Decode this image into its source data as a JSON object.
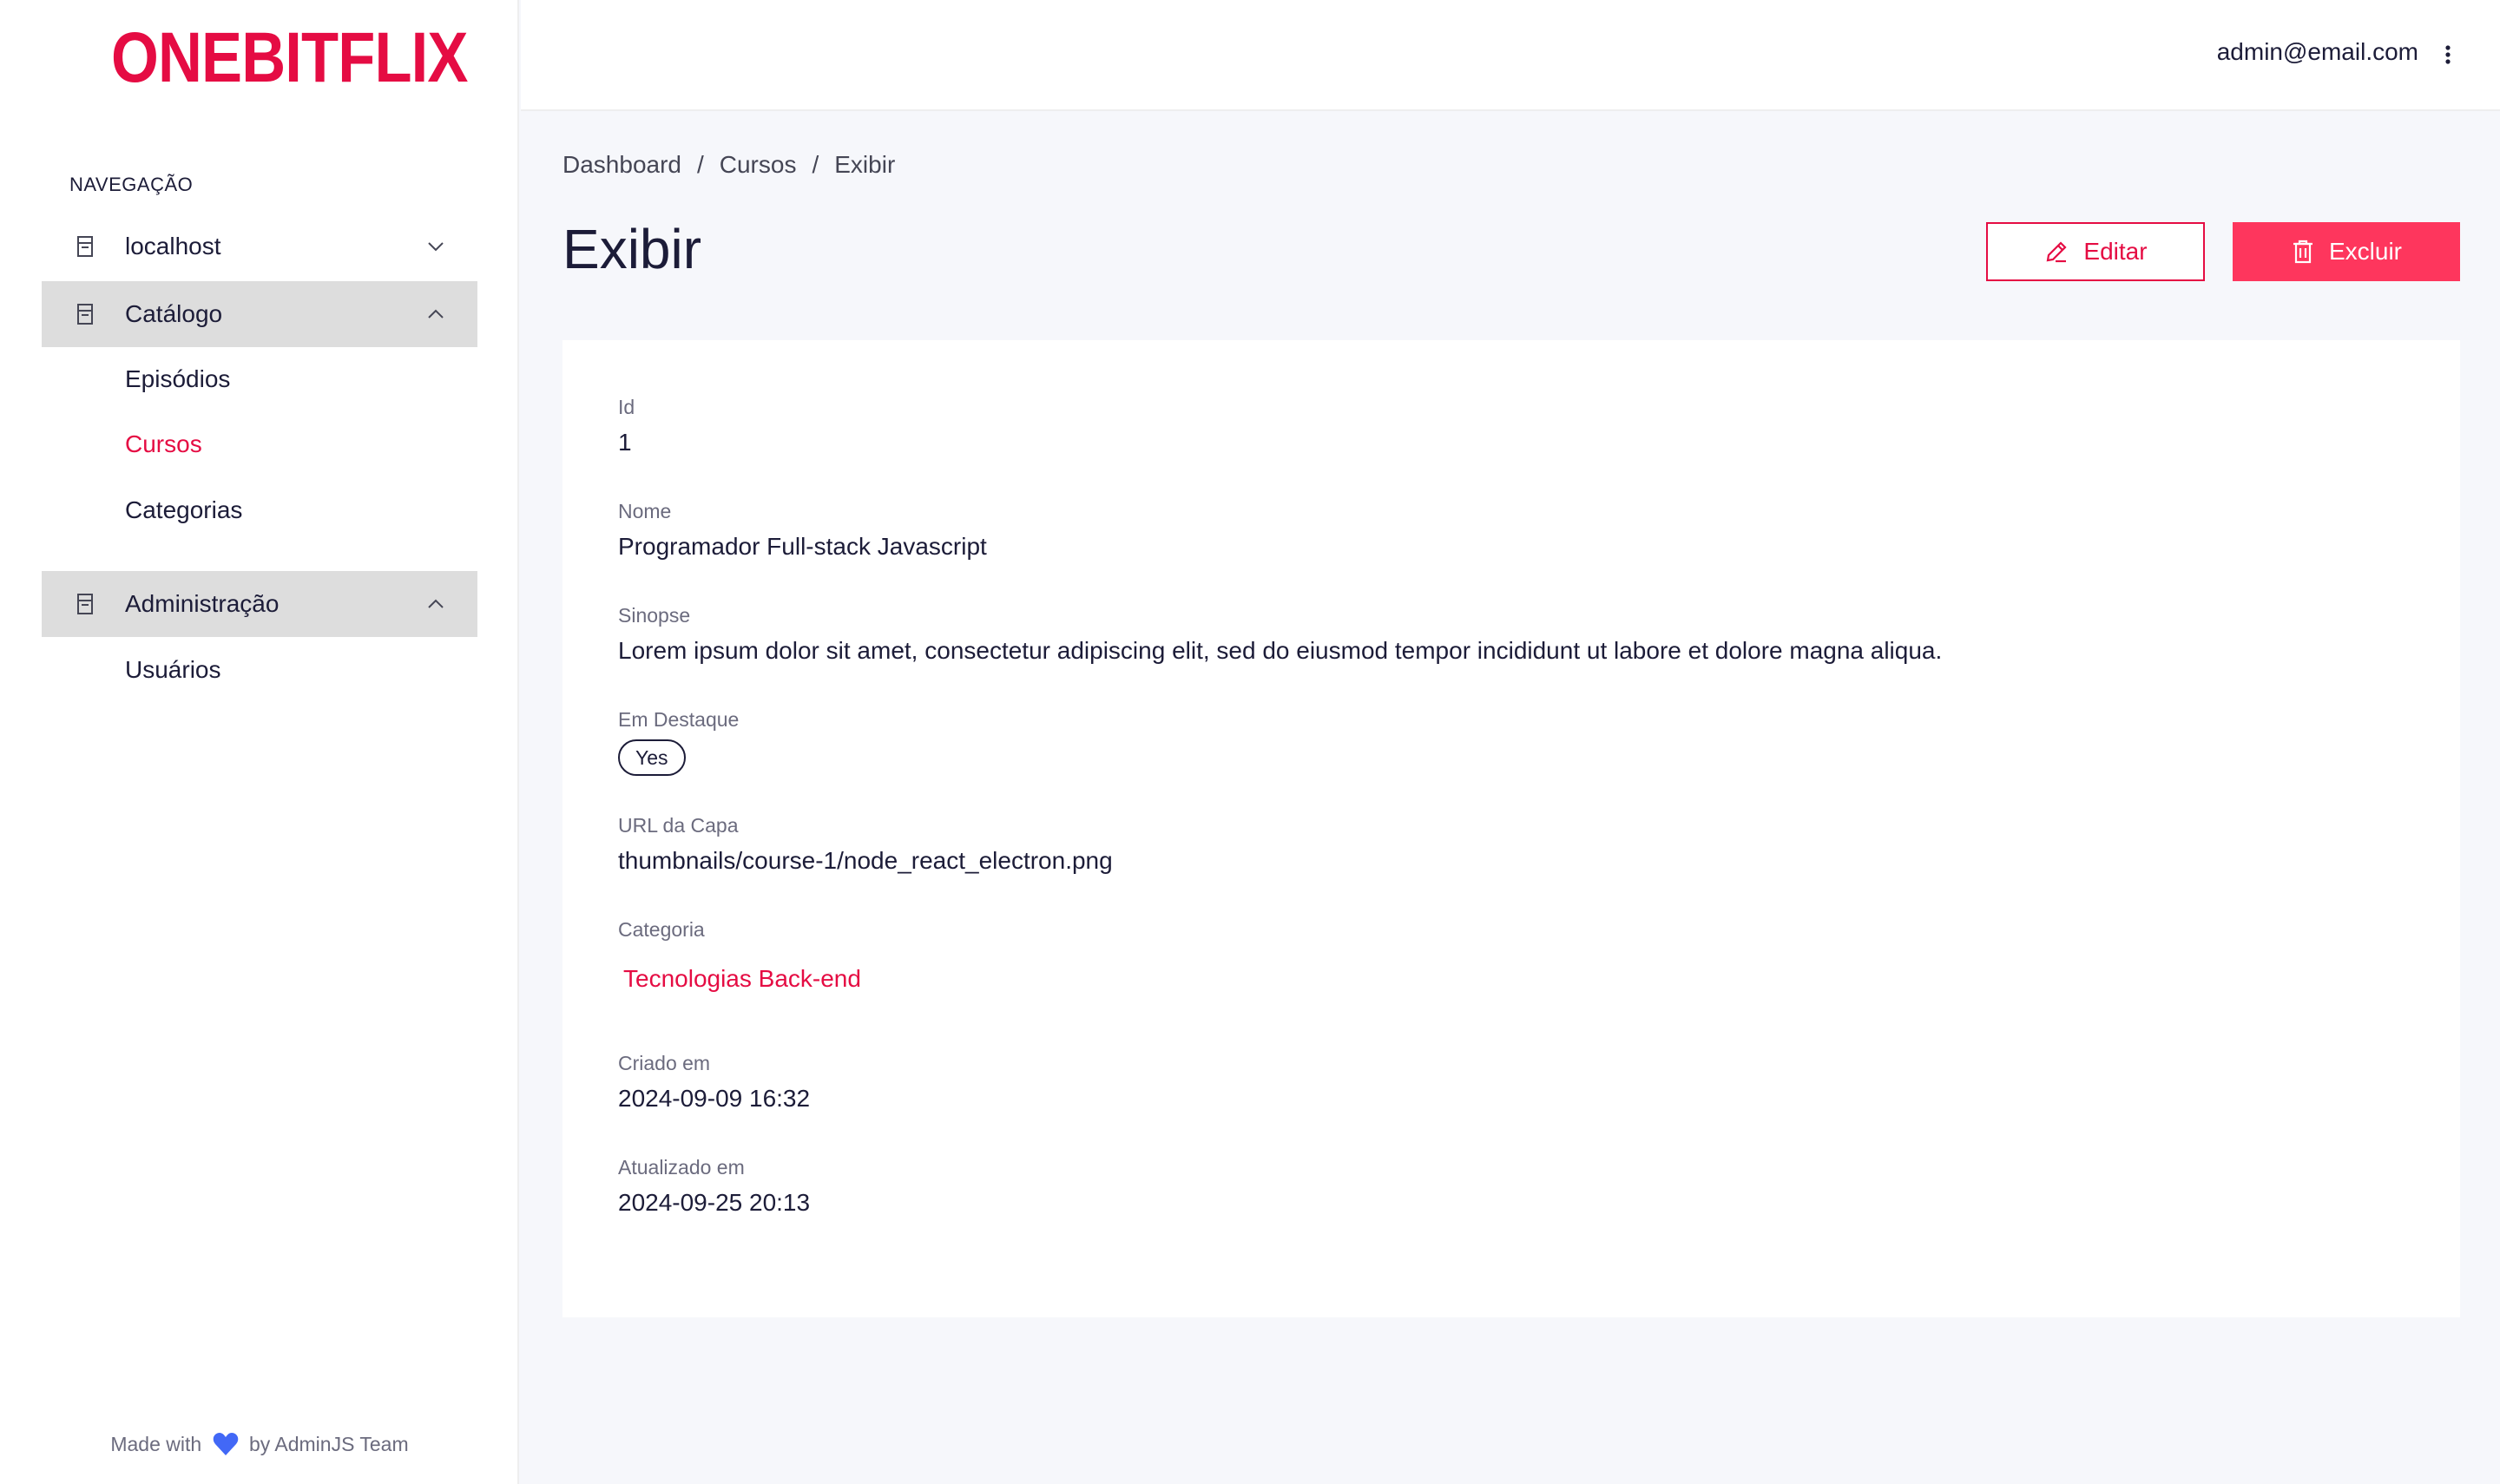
{
  "brand": {
    "logo_text": "ONEBITFLIX",
    "accent_color": "#e50c43",
    "danger_color": "#fe365d"
  },
  "sidebar": {
    "heading": "NAVEGAÇÃO",
    "groups": [
      {
        "label": "localhost",
        "icon": "database-icon",
        "expanded": false,
        "items": []
      },
      {
        "label": "Catálogo",
        "icon": "database-icon",
        "expanded": true,
        "items": [
          {
            "label": "Episódios",
            "current": false
          },
          {
            "label": "Cursos",
            "current": true
          },
          {
            "label": "Categorias",
            "current": false
          }
        ]
      },
      {
        "label": "Administração",
        "icon": "database-icon",
        "expanded": true,
        "items": [
          {
            "label": "Usuários",
            "current": false
          }
        ]
      }
    ],
    "footer": {
      "prefix": "Made with",
      "suffix": "by AdminJS Team",
      "heart_color": "#4268f6"
    }
  },
  "topbar": {
    "user_email": "admin@email.com"
  },
  "breadcrumb": [
    "Dashboard",
    "Cursos",
    "Exibir"
  ],
  "page": {
    "title": "Exibir",
    "actions": {
      "edit_label": "Editar",
      "delete_label": "Excluir"
    }
  },
  "record": {
    "fields": [
      {
        "label": "Id",
        "value": "1"
      },
      {
        "label": "Nome",
        "value": "Programador Full-stack Javascript"
      },
      {
        "label": "Sinopse",
        "value": "Lorem ipsum dolor sit amet, consectetur adipiscing elit, sed do eiusmod tempor incididunt ut labore et dolore magna aliqua."
      },
      {
        "label": "Em Destaque",
        "value": "Yes"
      },
      {
        "label": "URL da Capa",
        "value": "thumbnails/course-1/node_react_electron.png"
      },
      {
        "label": "Categoria",
        "value": "Tecnologias Back-end"
      },
      {
        "label": "Criado em",
        "value": "2024-09-09 16:32"
      },
      {
        "label": "Atualizado em",
        "value": "2024-09-25 20:13"
      }
    ]
  }
}
